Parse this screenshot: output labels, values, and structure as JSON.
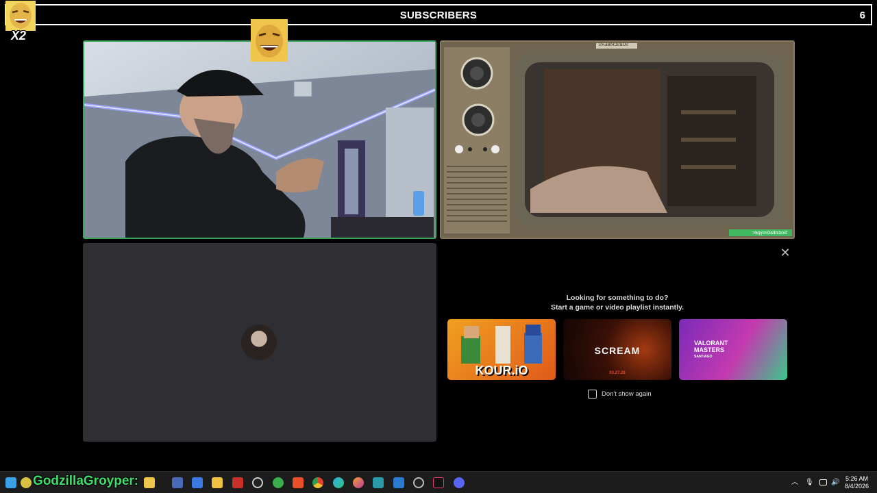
{
  "overlay": {
    "banner_title": "SUBSCRIBERS",
    "subscriber_count": "6",
    "multiplier": "X2",
    "chat_username": "GodzillaGroyper:"
  },
  "tv_overlay": {
    "banner_title": "SUBSCRIBERS",
    "username": "GodzillaGroyper:"
  },
  "activity_panel": {
    "heading": "Looking for something to do?",
    "subheading": "Start a game or video playlist instantly.",
    "cards": [
      {
        "title": "KOUR.iO",
        "icon": "kour-io-thumbnail"
      },
      {
        "title": "SCREAM",
        "icon": "scream-thumbnail",
        "date": "03.27.26"
      },
      {
        "title": "VALORANT MASTERS",
        "icon": "valorant-thumbnail",
        "subtitle": "SANTIAGO"
      }
    ],
    "dont_show_label": "Don't show again",
    "close_icon": "close-icon"
  },
  "taskbar": {
    "time": "5:26 AM",
    "date": "8/4/2026",
    "icons": [
      "start-icon",
      "copilot-icon",
      "outlook-icon",
      "remote-icon",
      "file-explorer-icon",
      "news-icon",
      "clock-app-icon",
      "maps-icon",
      "brave-icon",
      "chrome-icon",
      "edge-icon",
      "firefox-icon",
      "arduino-icon",
      "vscode-icon",
      "obs-icon",
      "tiktok-icon",
      "discord-icon"
    ],
    "tray": [
      "chevron-up-icon",
      "microphone-icon",
      "network-icon",
      "volume-icon"
    ]
  },
  "colors": {
    "speaking_border": "#3ba55c",
    "chat_name_color": "#3fe06a",
    "tile_bg": "#2f2f33"
  }
}
